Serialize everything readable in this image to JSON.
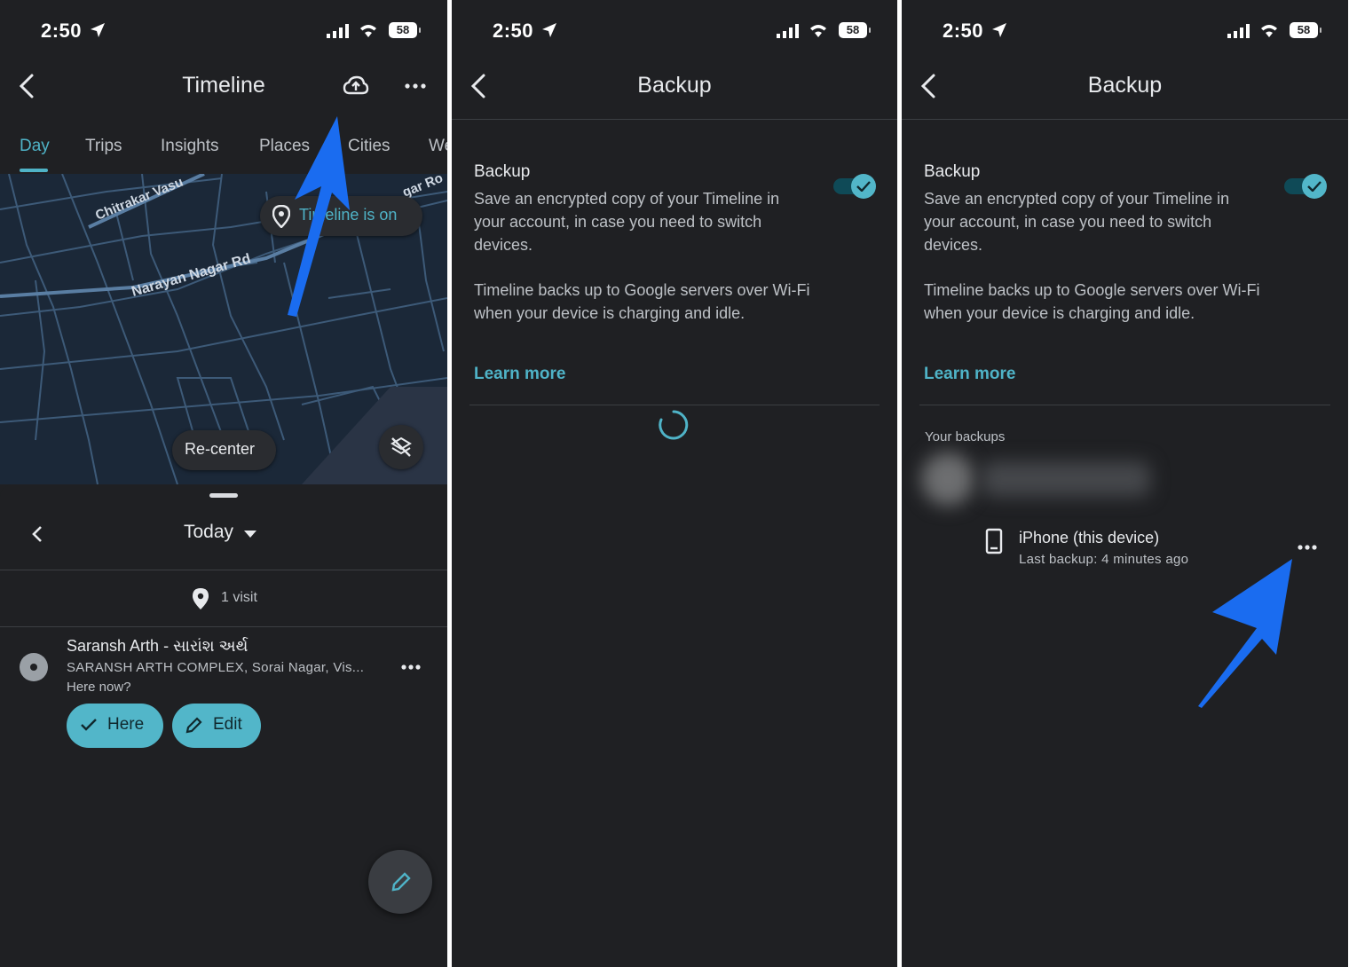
{
  "status": {
    "time": "2:50",
    "battery": "58"
  },
  "panel1": {
    "title": "Timeline",
    "tabs": [
      "Day",
      "Trips",
      "Insights",
      "Places",
      "Cities",
      "We"
    ],
    "map": {
      "roads": [
        "Chitrakar Vasu",
        "Narayan Nagar Rd",
        "gar Ro"
      ],
      "chip": "Timeline is on",
      "recenter": "Re-center"
    },
    "date": "Today",
    "visits": "1 visit",
    "place": {
      "name": "Saransh Arth - સારાંશ અર્થ",
      "address": "SARANSH ARTH COMPLEX, Sorai Nagar, Vis...",
      "prompt": "Here now?",
      "here_label": "Here",
      "edit_label": "Edit"
    }
  },
  "panel2": {
    "title": "Backup",
    "heading": "Backup",
    "desc": "Save an encrypted copy of your Timeline in your account, in case you need to switch devices.",
    "note": "Timeline backs up to Google servers over Wi-Fi when your device is charging and idle.",
    "learn_more": "Learn more",
    "toggle_on": true
  },
  "panel3": {
    "title": "Backup",
    "heading": "Backup",
    "desc": "Save an encrypted copy of your Timeline in your account, in case you need to switch devices.",
    "note": "Timeline backs up to Google servers over Wi-Fi when your device is charging and idle.",
    "learn_more": "Learn more",
    "your_backups": "Your backups",
    "device": {
      "name": "iPhone (this device)",
      "last_backup": "Last backup: 4 minutes ago"
    }
  },
  "colors": {
    "accent": "#4fb3c7",
    "annotation_arrow": "#1a6cf0",
    "background": "#1f2023"
  },
  "icons": [
    "back-arrow-icon",
    "cloud-upload-icon",
    "more-horiz-icon",
    "location-pin-icon",
    "layers-off-icon",
    "chevron-left-icon",
    "dropdown-icon",
    "check-icon",
    "pencil-icon",
    "phone-icon",
    "spinner-icon"
  ]
}
